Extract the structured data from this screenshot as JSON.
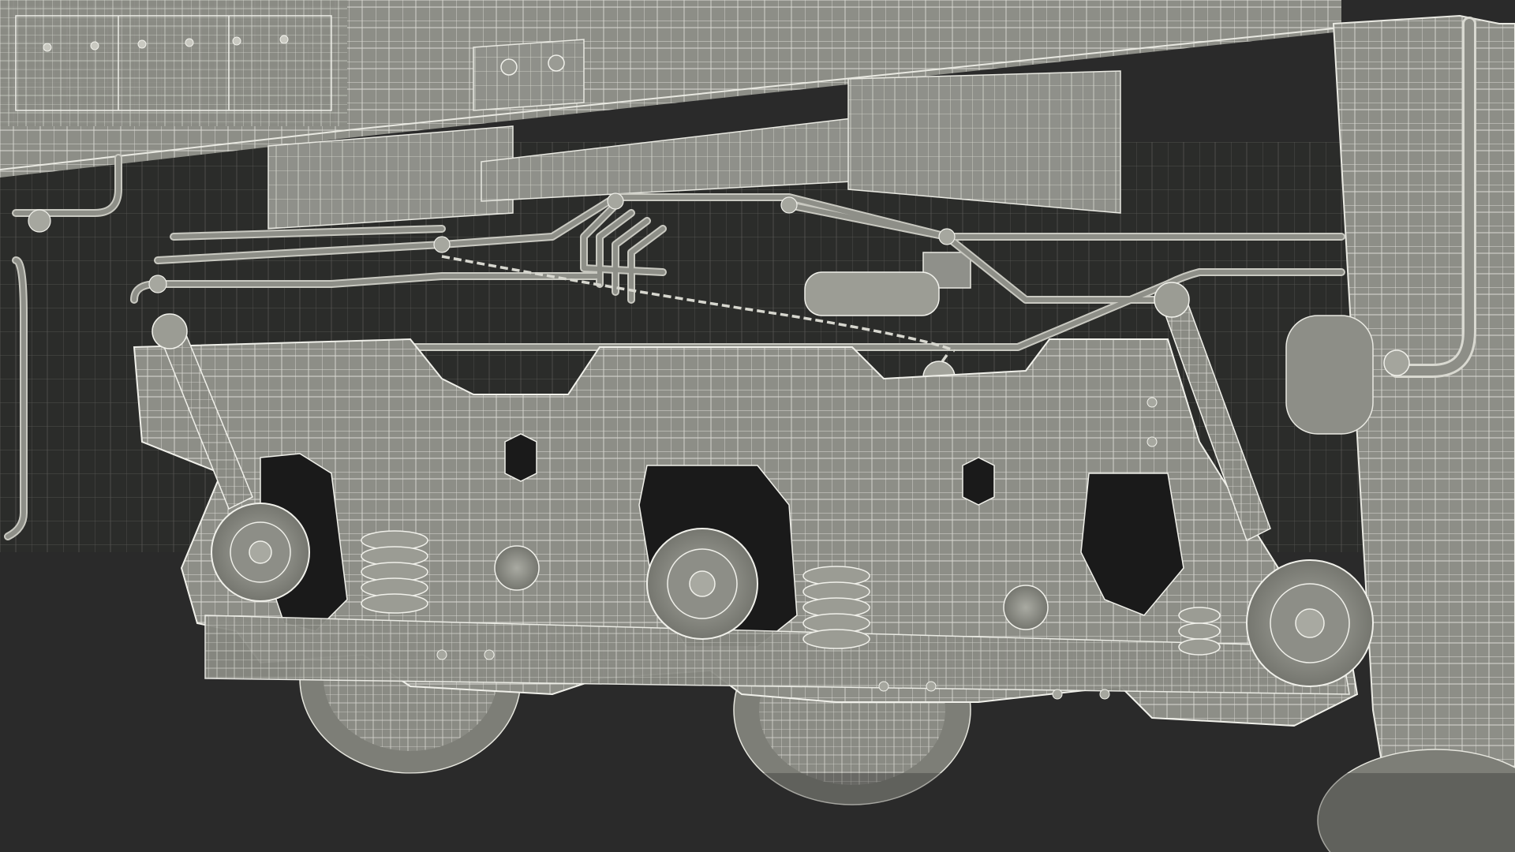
{
  "scene": {
    "subject": "locomotive-bogie-wireframe",
    "colors": {
      "ground": "#2a2a2a",
      "shadow": "#151515",
      "metal": "#8d8e87",
      "metal_light": "#a6a79f",
      "metal_dark": "#6f706a",
      "wire": "#e9e9e2",
      "chassis_gap": "#0f0f0f"
    },
    "parts": [
      "car-body-lower-panel",
      "underframe-beam",
      "equipment-boxes",
      "brake-pipes",
      "brake-chain",
      "bogie-side-frame",
      "axle-box-left",
      "axle-box-center",
      "axle-box-right",
      "coil-springs",
      "shock-absorbers",
      "wheels",
      "end-pillar"
    ]
  }
}
